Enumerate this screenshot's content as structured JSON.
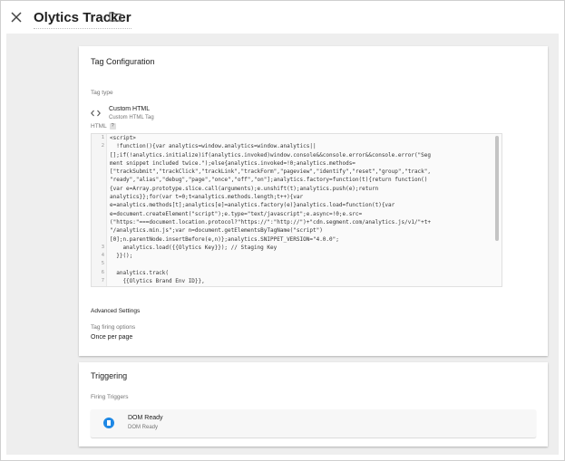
{
  "header": {
    "title": "Olytics Tracker"
  },
  "tag_config": {
    "section_title": "Tag Configuration",
    "tag_type_label": "Tag type",
    "tag_type_name": "Custom HTML",
    "tag_type_desc": "Custom HTML Tag",
    "html_label": "HTML",
    "help_glyph": "?",
    "line_numbers": [
      "1",
      "2",
      "",
      "",
      "",
      "",
      "",
      "",
      "",
      "",
      "",
      "",
      "",
      "3",
      "4",
      "5",
      "6",
      "7"
    ],
    "code_lines": [
      "<script>",
      "  !function(){var analytics=window.analytics=window.analytics||",
      "[];if(!analytics.initialize)if(analytics.invoked)window.console&&console.error&&console.error(\"Seg",
      "ment snippet included twice.\");else{analytics.invoked=!0;analytics.methods=",
      "[\"trackSubmit\",\"trackClick\",\"trackLink\",\"trackForm\",\"pageview\",\"identify\",\"reset\",\"group\",\"track\",",
      "\"ready\",\"alias\",\"debug\",\"page\",\"once\",\"off\",\"on\"];analytics.factory=function(t){return function()",
      "{var e=Array.prototype.slice.call(arguments);e.unshift(t);analytics.push(e);return",
      "analytics}};for(var t=0;t<analytics.methods.length;t++){var",
      "e=analytics.methods[t];analytics[e]=analytics.factory(e)}analytics.load=function(t){var",
      "e=document.createElement(\"script\");e.type=\"text/javascript\";e.async=!0;e.src=",
      "(\"https:\"===document.location.protocol?\"https://\":\"http://\")+\"cdn.segment.com/analytics.js/v1/\"+t+",
      "\"/analytics.min.js\";var n=document.getElementsByTagName(\"script\")",
      "[0];n.parentNode.insertBefore(e,n)};analytics.SNIPPET_VERSION=\"4.0.0\";",
      "    analytics.load({{Olytics Key}}); // Staging Key",
      "  }}();",
      "",
      "  analytics.track(",
      "    {{Olytics Brand Env ID}},"
    ],
    "advanced_settings": "Advanced Settings",
    "firing_options_label": "Tag firing options",
    "firing_options_value": "Once per page"
  },
  "triggering": {
    "section_title": "Triggering",
    "firing_triggers_label": "Firing Triggers",
    "trigger_name": "DOM Ready",
    "trigger_type": "DOM Ready"
  },
  "colors": {
    "trigger_icon": "#1e88e5",
    "background": "#eeeeee"
  },
  "icons": {
    "close": "close-icon",
    "folder": "folder-icon",
    "tag_type": "code-icon",
    "trigger": "page-icon"
  }
}
